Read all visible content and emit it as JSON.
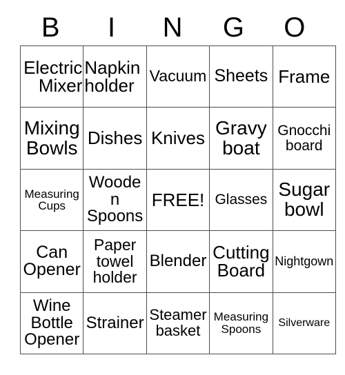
{
  "card": {
    "title": "Bingo Card",
    "header": {
      "letters": [
        "B",
        "I",
        "N",
        "G",
        "O"
      ]
    },
    "columns": 5,
    "rows": 5,
    "free_space_label": "FREE!",
    "colors": {
      "background": "#ffffff",
      "text": "#000000",
      "grid_line": "#4d4d4d"
    },
    "cells": [
      [
        {
          "text": "Electric\nMixer",
          "size": "fs-26",
          "align": "al-right"
        },
        {
          "text": "Napkin\nholder",
          "size": "fs-26",
          "align": "al-left"
        },
        {
          "text": "Vacuum",
          "size": "fs-23",
          "align": "al-center"
        },
        {
          "text": "Sheets",
          "size": "fs-25",
          "align": "al-center"
        },
        {
          "text": "Frame",
          "size": "fs-26",
          "align": "al-center"
        }
      ],
      [
        {
          "text": "Mixing\nBowls",
          "size": "fs-28",
          "align": "al-center"
        },
        {
          "text": "Dishes",
          "size": "fs-26",
          "align": "al-center"
        },
        {
          "text": "Knives",
          "size": "fs-26",
          "align": "al-center"
        },
        {
          "text": "Gravy\nboat",
          "size": "fs-28",
          "align": "al-center"
        },
        {
          "text": "Gnocchi\nboard",
          "size": "fs-21",
          "align": "al-center"
        }
      ],
      [
        {
          "text": "Measuring\nCups",
          "size": "fs-17",
          "align": "al-center"
        },
        {
          "text": "Wooden\nSpoons",
          "size": "fs-24",
          "align": "al-center"
        },
        {
          "text": "FREE!",
          "size": "fs-26",
          "align": "al-center"
        },
        {
          "text": "Glasses",
          "size": "fs-21",
          "align": "al-center"
        },
        {
          "text": "Sugar\nbowl",
          "size": "fs-28",
          "align": "al-center"
        }
      ],
      [
        {
          "text": "Can\nOpener",
          "size": "fs-25",
          "align": "al-center"
        },
        {
          "text": "Paper\ntowel\nholder",
          "size": "fs-23",
          "align": "al-center"
        },
        {
          "text": "Blender",
          "size": "fs-24",
          "align": "al-center"
        },
        {
          "text": "Cutting\nBoard",
          "size": "fs-26",
          "align": "al-center"
        },
        {
          "text": "Nightgown",
          "size": "fs-18",
          "align": "al-center"
        }
      ],
      [
        {
          "text": "Wine\nBottle\nOpener",
          "size": "fs-24",
          "align": "al-center"
        },
        {
          "text": "Strainer",
          "size": "fs-24",
          "align": "al-center"
        },
        {
          "text": "Steamer\nbasket",
          "size": "fs-22",
          "align": "al-center"
        },
        {
          "text": "Measuring\nSpoons",
          "size": "fs-17",
          "align": "al-center"
        },
        {
          "text": "Silverware",
          "size": "fs-16",
          "align": "al-center"
        }
      ]
    ]
  }
}
